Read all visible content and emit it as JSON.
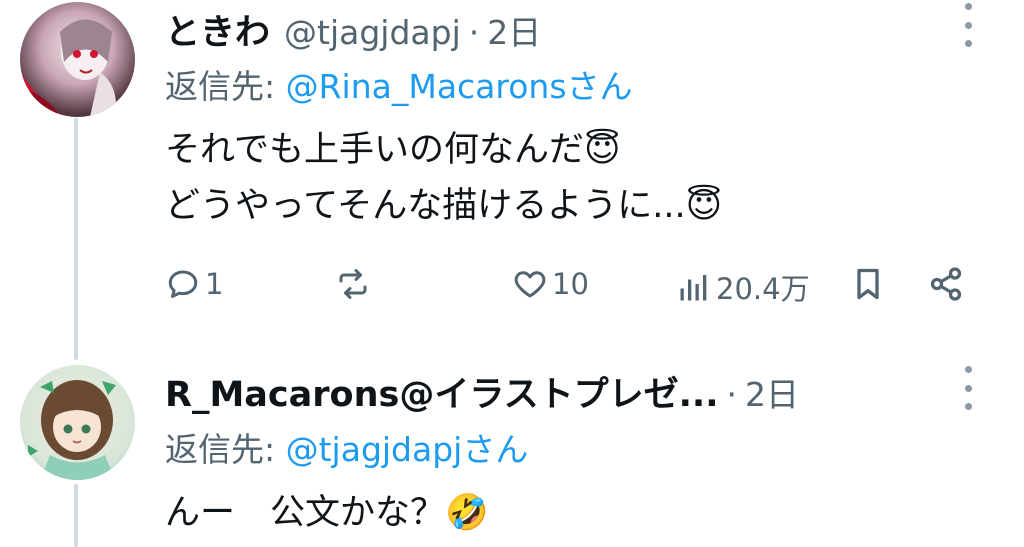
{
  "tweet1": {
    "display_name": "ときわ",
    "handle": "@tjagjdapj",
    "separator": "·",
    "time": "2日",
    "reply_prefix": "返信先: ",
    "reply_mention": "@Rina_Macarons",
    "reply_suffix": "さん",
    "text_line1": "それでも上手いの何なんだ",
    "text_line2": "どうやってそんな描けるように...",
    "emoji": "😇",
    "actions": {
      "reply_count": "1",
      "like_count": "10",
      "views_count": "20.4万"
    }
  },
  "tweet2": {
    "display_name": "R_Macarons@イラストプレゼ...",
    "separator": "·",
    "time": "2日",
    "reply_prefix": "返信先: ",
    "reply_mention": "@tjagjdapj",
    "reply_suffix": "さん",
    "text_line1": "んー　公文かな？",
    "emoji": "🤣"
  },
  "colors": {
    "text": "#0f1419",
    "secondary": "#536471",
    "link": "#1d9bf0",
    "thread_line": "#cfd9de"
  }
}
